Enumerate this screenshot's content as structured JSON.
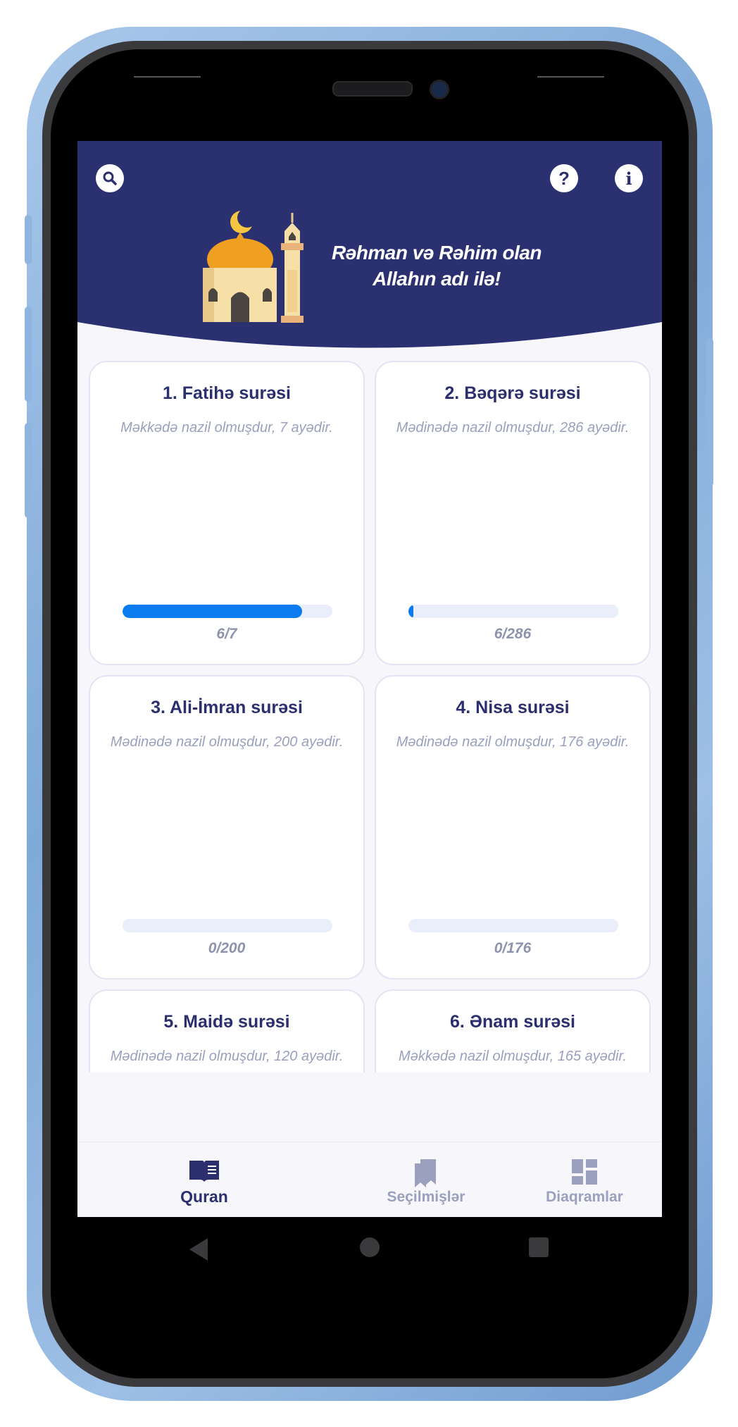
{
  "header": {
    "greeting_line1": "Rəhman və Rəhim olan",
    "greeting_line2": "Allahın adı ilə!",
    "background_color": "#2b3170",
    "icons": [
      "search-icon",
      "help-icon",
      "info-icon"
    ],
    "help_glyph": "?",
    "info_glyph": "i"
  },
  "surahs": [
    {
      "title": "1. Fatihə surəsi",
      "subtitle": "Məkkədə nazil olmuşdur, 7 ayədir.",
      "progress_label": "6/7",
      "read": 6,
      "total": 7
    },
    {
      "title": "2. Bəqərə surəsi",
      "subtitle": "Mədinədə nazil olmuşdur, 286 ayədir.",
      "progress_label": "6/286",
      "read": 6,
      "total": 286
    },
    {
      "title": "3. Ali-İmran surəsi",
      "subtitle": "Mədinədə nazil olmuşdur, 200 ayədir.",
      "progress_label": "0/200",
      "read": 0,
      "total": 200
    },
    {
      "title": "4. Nisa surəsi",
      "subtitle": "Mədinədə nazil olmuşdur, 176 ayədir.",
      "progress_label": "0/176",
      "read": 0,
      "total": 176
    },
    {
      "title": "5. Maidə surəsi",
      "subtitle": "Mədinədə nazil olmuşdur, 120 ayədir."
    },
    {
      "title": "6. Ənam surəsi",
      "subtitle": "Məkkədə nazil olmuşdur, 165 ayədir."
    }
  ],
  "bottom_nav": {
    "items": [
      {
        "label": "Quran",
        "icon": "book-icon",
        "active": true
      },
      {
        "label": "Seçilmişlər",
        "icon": "bookmarks-icon",
        "active": false
      },
      {
        "label": "Diaqramlar",
        "icon": "dashboard-icon",
        "active": false
      }
    ],
    "active_color": "#2b2f6e",
    "inactive_color": "#9aa0bd"
  },
  "progress_color": "#0a7cf0",
  "system_nav": [
    "back-icon",
    "home-icon",
    "recents-icon"
  ]
}
